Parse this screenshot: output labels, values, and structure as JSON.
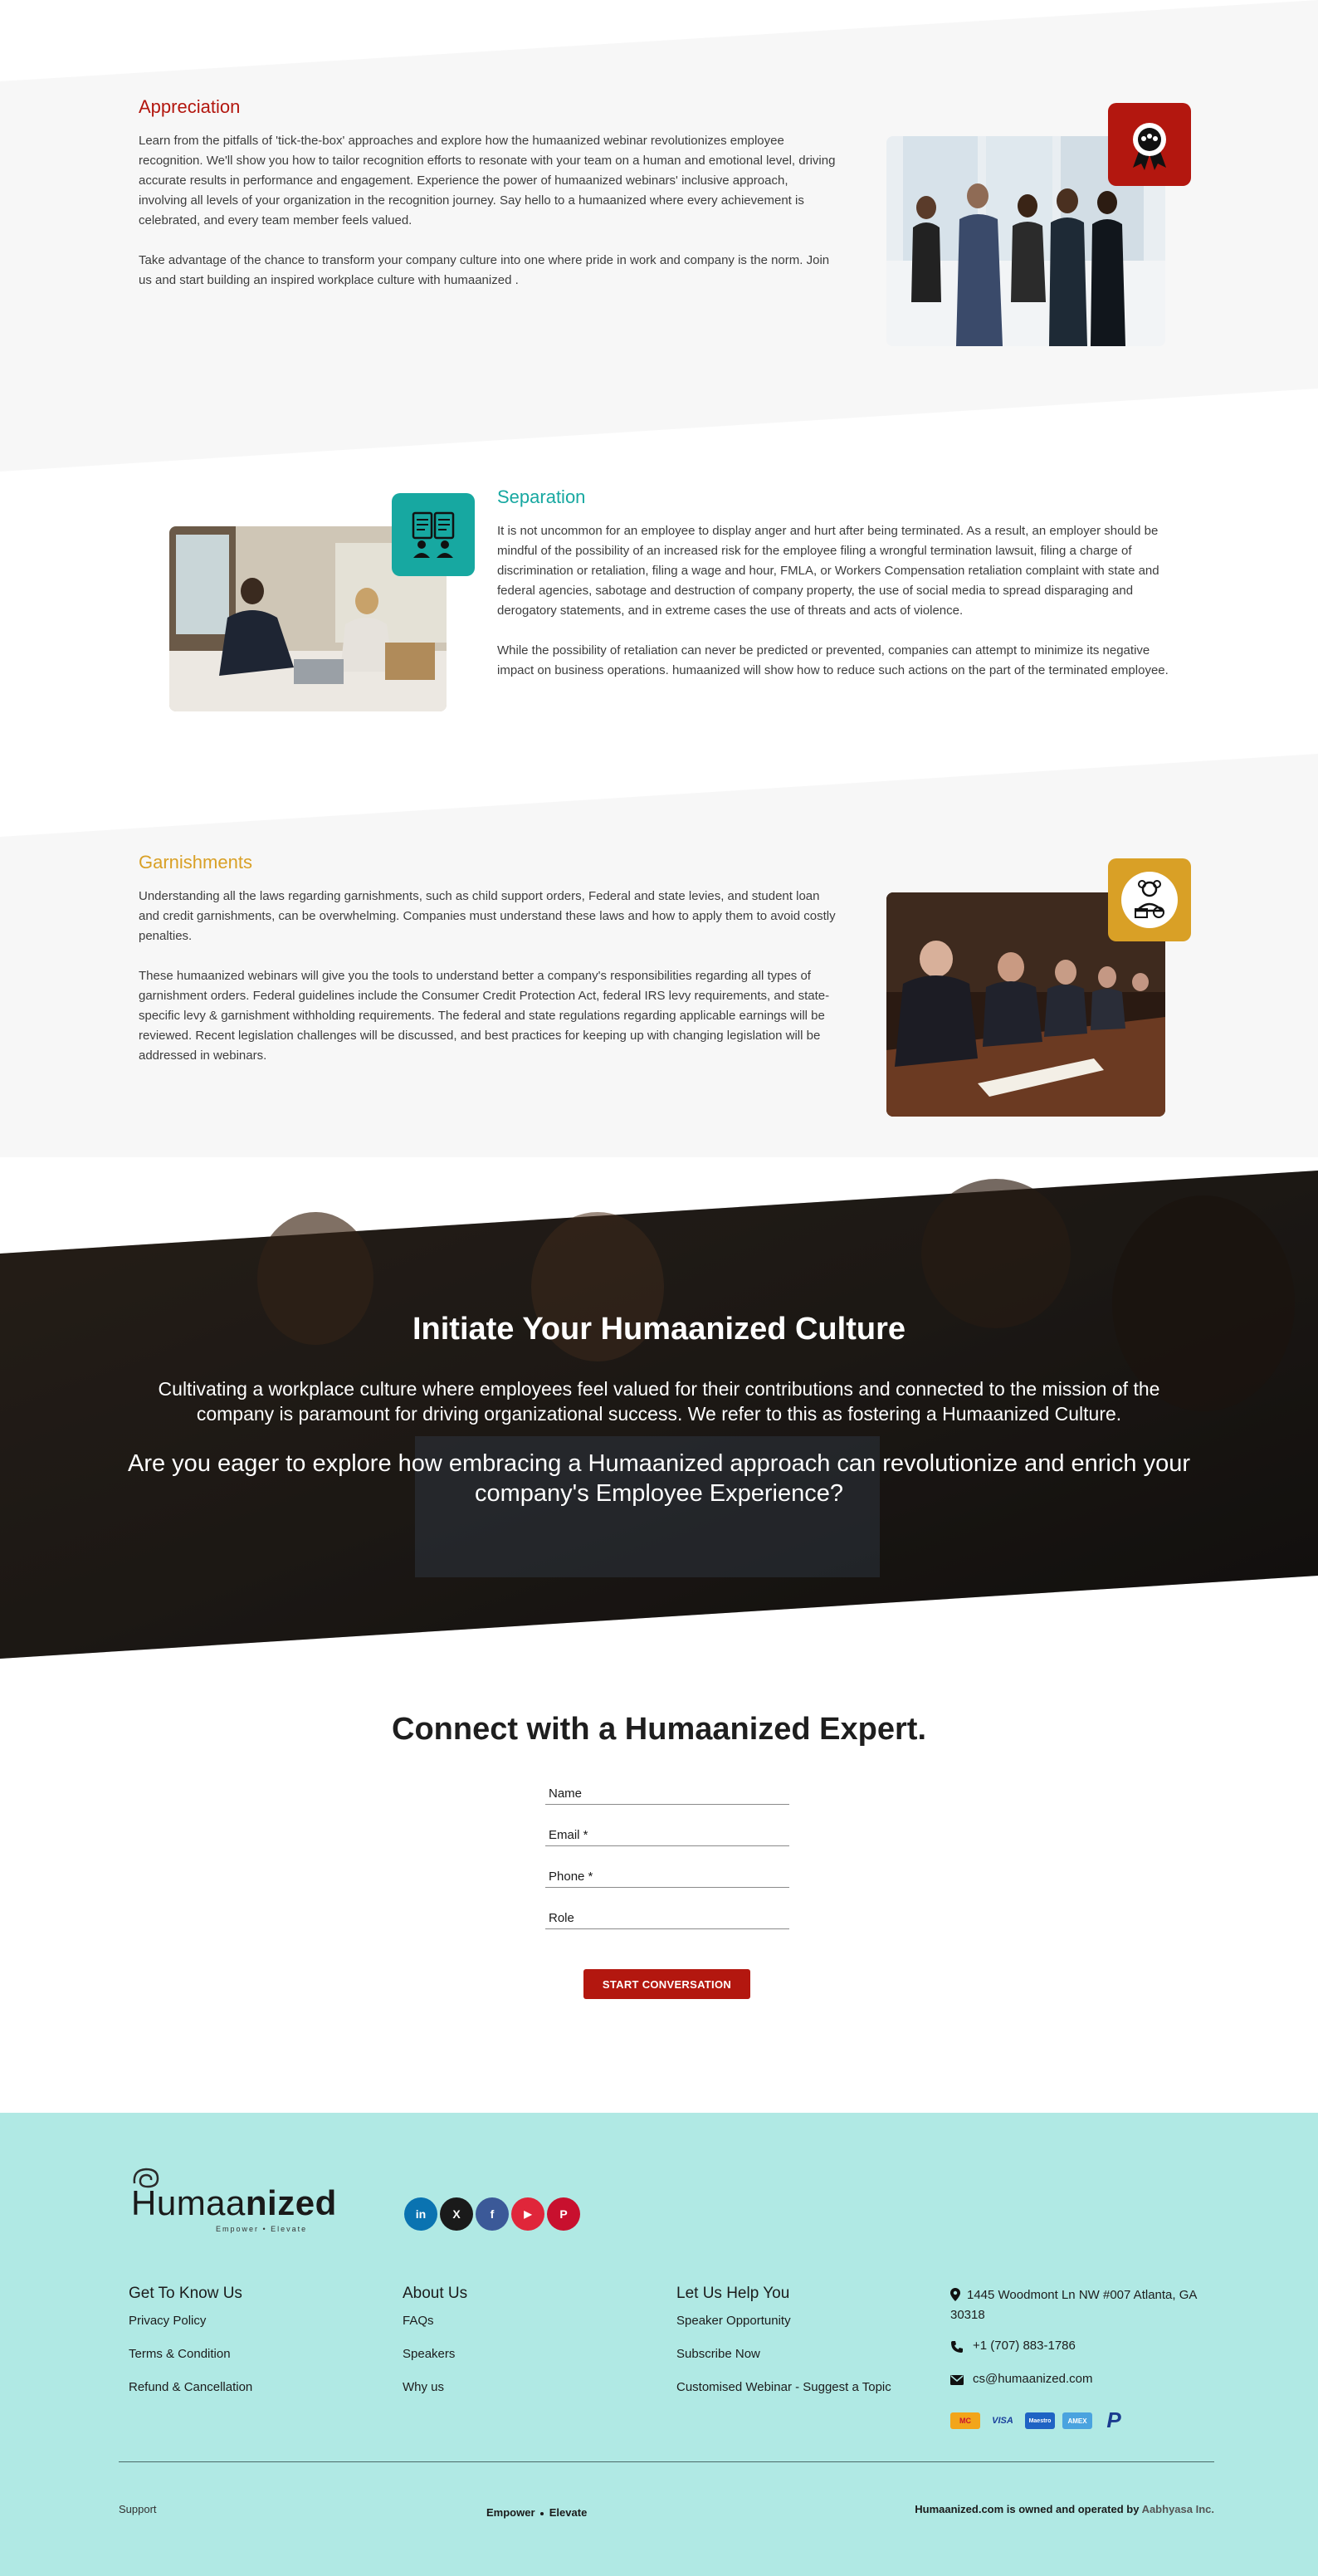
{
  "appreciation": {
    "title": "Appreciation",
    "p1": "Learn from the pitfalls of 'tick-the-box' approaches and explore how the humaanized webinar revolutionizes employee recognition. We'll show you how to tailor recognition efforts to resonate with your team on a human and emotional level, driving accurate results in performance and engagement. Experience the power of humaanized webinars' inclusive approach, involving all levels of your organization in the recognition journey. Say hello to a humaanized where every achievement is celebrated, and every team member feels valued.",
    "p2": "Take advantage of the chance to transform your company culture into one where pride in work and company is the norm. Join us and start building an inspired workplace culture with humaanized ."
  },
  "separation": {
    "title": "Separation",
    "p1": "It is not uncommon for an employee to display anger and hurt after being terminated. As a result, an employer should be mindful of the possibility of an increased risk for the employee filing a wrongful termination lawsuit, filing a charge of discrimination or retaliation, filing a wage and hour, FMLA, or Workers Compensation retaliation complaint with state and federal agencies, sabotage and destruction of company property, the use of social media to spread disparaging and derogatory statements, and in extreme cases the use of threats and acts of violence.",
    "p2": "While the possibility of retaliation can never be predicted or prevented, companies can attempt to minimize its negative impact on business operations. humaanized will show how to reduce such actions on the part of the terminated employee."
  },
  "garnishments": {
    "title": "Garnishments",
    "p1": "Understanding all the laws regarding garnishments, such as child support orders, Federal and state levies, and student loan and credit garnishments, can be overwhelming. Companies must understand these laws and how to apply them to avoid costly penalties.",
    "p2": "These humaanized webinars will give you the tools to understand better a company's responsibilities regarding all types of garnishment orders. Federal guidelines include the Consumer Credit Protection Act, federal IRS levy requirements, and state-specific levy & garnishment withholding requirements. The federal and state regulations regarding applicable earnings will be reviewed. Recent legislation challenges will be discussed, and best practices for keeping up with changing legislation will be addressed in webinars."
  },
  "cta": {
    "title": "Initiate Your Humaanized Culture",
    "subtitle": "Cultivating a workplace culture where employees feel valued for their contributions and connected to the mission of the company is paramount for driving organizational success. We refer to this as fostering a Humaanized Culture.",
    "question": "Are you eager to explore how embracing a Humaanized approach can revolutionize and enrich your company's Employee Experience?"
  },
  "form": {
    "title": "Connect with a Humaanized Expert.",
    "name_label": "Name",
    "email_label": "Email *",
    "phone_label": "Phone *",
    "role_label": "Role",
    "submit_label": "START CONVERSATION"
  },
  "footer": {
    "logo_text_a": "Humaa",
    "logo_text_b": "nized",
    "logo_tagline": "Empower • Elevate",
    "social": [
      "in",
      "X",
      "f",
      "▶",
      "P"
    ],
    "col1": {
      "title": "Get To Know Us",
      "links": [
        "Privacy Policy",
        "Terms & Condition",
        "Refund & Cancellation"
      ]
    },
    "col2": {
      "title": "About Us",
      "links": [
        "FAQs",
        "Speakers",
        "Why us"
      ]
    },
    "col3": {
      "title": "Let Us Help You",
      "links": [
        "Speaker Opportunity",
        "Subscribe Now",
        "Customised Webinar - Suggest a Topic"
      ]
    },
    "address": "1445 Woodmont Ln NW #007 Atlanta, GA 30318",
    "phone": "+1 (707) 883-1786",
    "email": "cs@humaanized.com",
    "cards": [
      "MC",
      "VISA",
      "Maestro",
      "AMEX",
      "P"
    ],
    "bottom_left": "Support",
    "bottom_center_a": "Empower",
    "bottom_center_b": "Elevate",
    "bottom_right_a": "Humaanized.com is owned and operated by ",
    "bottom_right_b": "Aabhyasa Inc."
  },
  "colors": {
    "appreciation": "#b3170f",
    "separation": "#17a8a1",
    "garnishments": "#d9a026",
    "footer_bg": "#b0e9e4",
    "button": "#b3170f"
  }
}
